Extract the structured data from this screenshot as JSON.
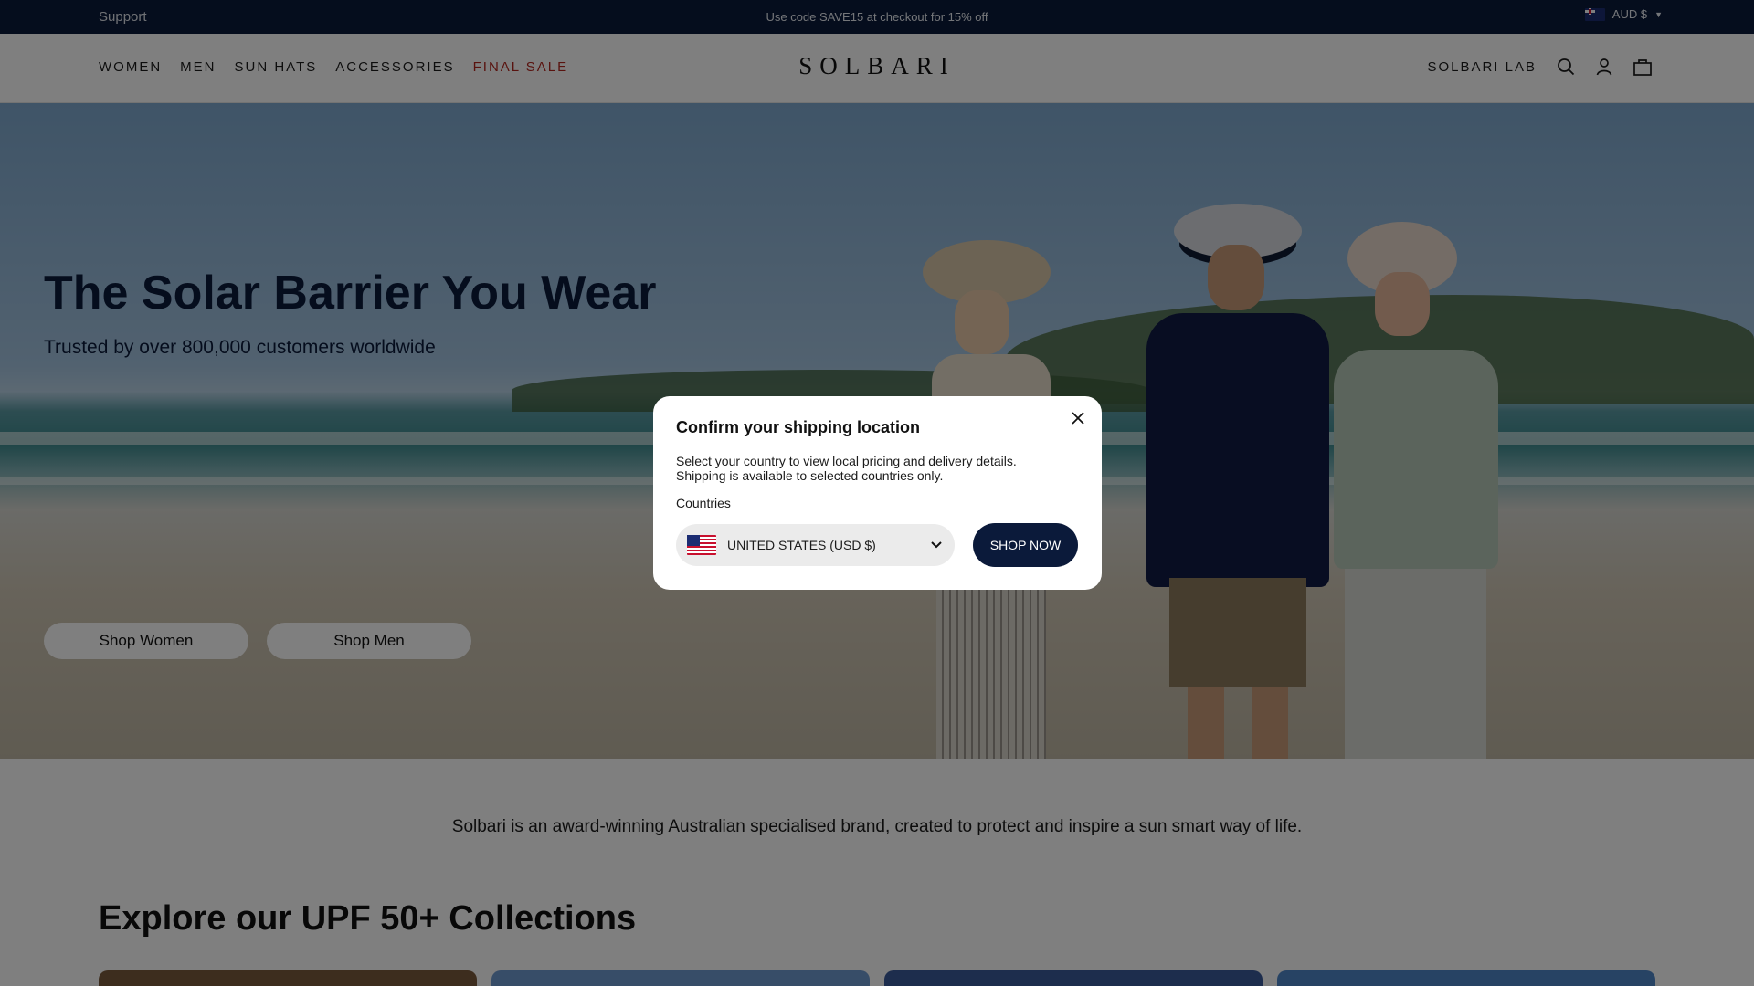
{
  "topbar": {
    "support": "Support",
    "promo": "Use code SAVE15 at checkout for 15% off",
    "currency": "AUD $",
    "currency_flag_icon": "flag-au-icon"
  },
  "header": {
    "nav_left": [
      "WOMEN",
      "MEN",
      "SUN HATS",
      "ACCESSORIES",
      "FINAL SALE"
    ],
    "logo": "SOLBARI",
    "lab": "SOLBARI LAB",
    "icons": [
      "search-icon",
      "account-icon",
      "bag-icon"
    ]
  },
  "hero": {
    "title": "The Solar Barrier You Wear",
    "subtitle": "Trusted by over 800,000 customers worldwide",
    "buttons": [
      "Shop Women",
      "Shop Men"
    ]
  },
  "about": "Solbari is an award-winning Australian specialised brand, created to protect and inspire a sun smart way of life.",
  "collections": {
    "title": "Explore our UPF 50+ Collections"
  },
  "modal": {
    "title": "Confirm your shipping location",
    "desc_line1": "Select your country to view local pricing and delivery details.",
    "desc_line2": "Shipping is available to selected countries only.",
    "label": "Countries",
    "selected": "UNITED STATES (USD $)",
    "cta": "SHOP NOW"
  },
  "colors": {
    "navy": "#0b1a3a",
    "sale_red": "#b3261e"
  }
}
